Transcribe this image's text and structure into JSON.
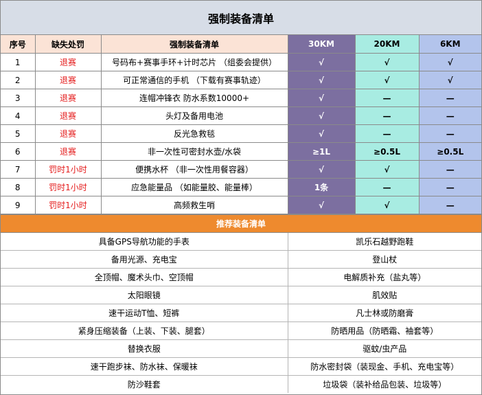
{
  "title": "强制装备清单",
  "mandatory": {
    "headers": {
      "no": "序号",
      "penalty": "缺失处罚",
      "item": "强制装备清单",
      "d30": "30KM",
      "d20": "20KM",
      "d6": "6KM"
    },
    "rows": [
      {
        "no": "1",
        "penalty": "退赛",
        "item": "号码布+赛事手环+计时芯片 （组委会提供）",
        "d30": "√",
        "d20": "√",
        "d6": "√"
      },
      {
        "no": "2",
        "penalty": "退赛",
        "item": "可正常通信的手机 （下载有赛事轨迹）",
        "d30": "√",
        "d20": "√",
        "d6": "√"
      },
      {
        "no": "3",
        "penalty": "退赛",
        "item": "连帽冲锋衣 防水系数10000+",
        "d30": "√",
        "d20": "—",
        "d6": "—"
      },
      {
        "no": "4",
        "penalty": "退赛",
        "item": "头灯及备用电池",
        "d30": "√",
        "d20": "—",
        "d6": "—"
      },
      {
        "no": "5",
        "penalty": "退赛",
        "item": "反光急救毯",
        "d30": "√",
        "d20": "—",
        "d6": "—"
      },
      {
        "no": "6",
        "penalty": "退赛",
        "item": "非一次性可密封水壶/水袋",
        "d30": "≥1L",
        "d20": "≥0.5L",
        "d6": "≥0.5L"
      },
      {
        "no": "7",
        "penalty": "罚时1小时",
        "item": "便携水杯 （非一次性用餐容器）",
        "d30": "√",
        "d20": "√",
        "d6": "—"
      },
      {
        "no": "8",
        "penalty": "罚时1小时",
        "item": "应急能量品 （如能量胶、能量棒）",
        "d30": "1条",
        "d20": "—",
        "d6": "—"
      },
      {
        "no": "9",
        "penalty": "罚时1小时",
        "item": "高频救生哨",
        "d30": "√",
        "d20": "√",
        "d6": "—"
      }
    ]
  },
  "recommended": {
    "title": "推荐装备清单",
    "rows": [
      [
        "具备GPS导航功能的手表",
        "凯乐石越野跑鞋"
      ],
      [
        "备用光源、充电宝",
        "登山杖"
      ],
      [
        "全顶帽、魔术头巾、空顶帽",
        "电解质补充（盐丸等）"
      ],
      [
        "太阳眼镜",
        "肌效贴"
      ],
      [
        "速干运动T恤、短裤",
        "凡士林或防磨膏"
      ],
      [
        "紧身压缩装备（上装、下装、腿套）",
        "防晒用品（防晒霜、袖套等）"
      ],
      [
        "替换衣服",
        "驱蚊/虫产品"
      ],
      [
        "速干跑步袜、防水袜、保暖袜",
        "防水密封袋（装现金、手机、充电宝等）"
      ],
      [
        "防沙鞋套",
        "垃圾袋（装补给品包装、垃圾等）"
      ]
    ]
  }
}
